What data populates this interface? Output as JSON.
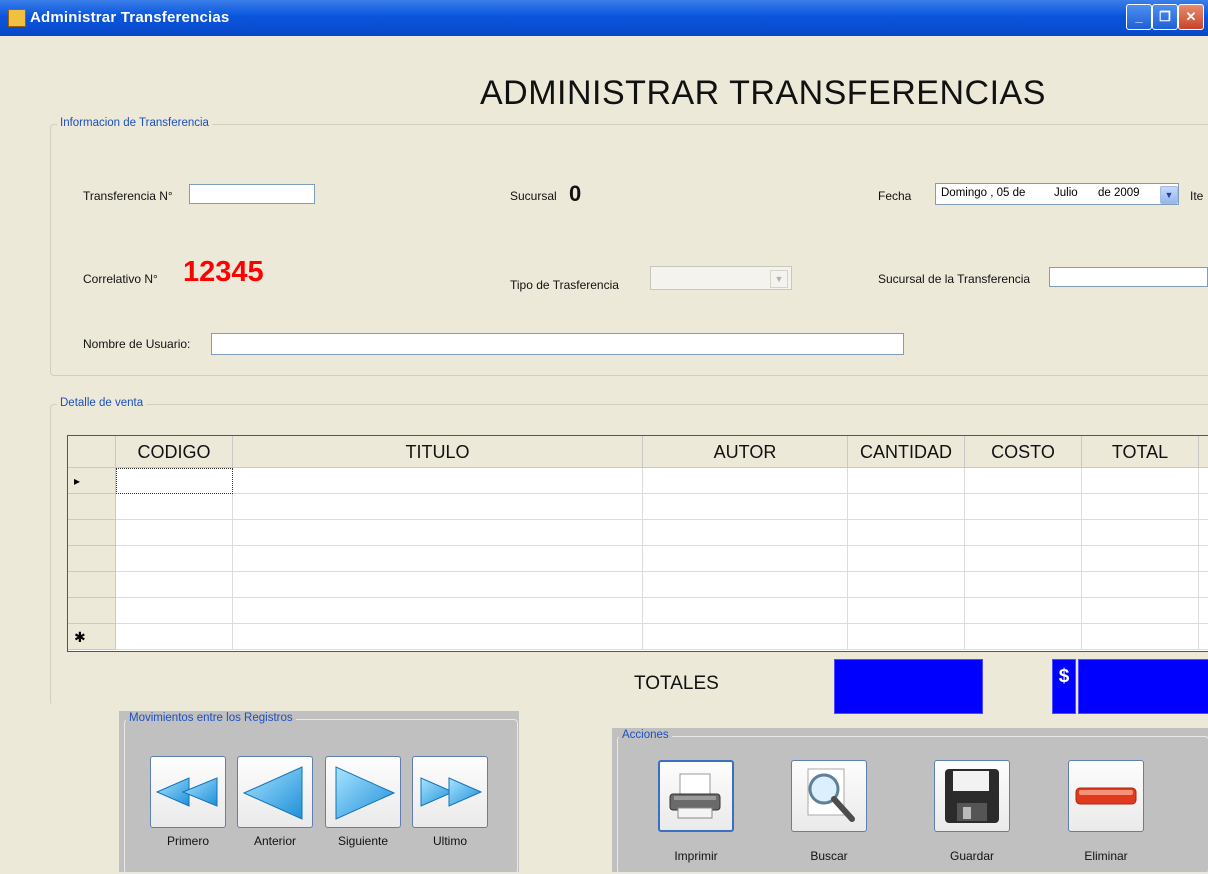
{
  "window": {
    "title": "Administrar Transferencias",
    "minimize_glyph": "_",
    "maximize_glyph": "❐",
    "close_glyph": "✕"
  },
  "page_title": "ADMINISTRAR TRANSFERENCIAS",
  "info_group": {
    "legend": "Informacion de Transferencia",
    "transferencia_label": "Transferencia N°",
    "transferencia_value": "",
    "sucursal_label": "Sucursal",
    "sucursal_value": "0",
    "fecha_label": "Fecha",
    "fecha_weekday": "Domingo , 05 de",
    "fecha_month": "Julio",
    "fecha_year": "de 2009",
    "items_label_partial": "Ite",
    "correlativo_label": "Correlativo N°",
    "correlativo_value": "12345",
    "tipo_label": "Tipo de Trasferencia",
    "tipo_value": "",
    "sucursal_transf_label": "Sucursal de la Transferencia",
    "sucursal_transf_value": "",
    "usuario_label": "Nombre de Usuario:",
    "usuario_value": ""
  },
  "detail_group": {
    "legend": "Detalle de venta",
    "columns": [
      "CODIGO",
      "TITULO",
      "AUTOR",
      "CANTIDAD",
      "COSTO",
      "TOTAL"
    ],
    "current_row_marker": "▸",
    "new_row_marker": "✱"
  },
  "totals": {
    "label": "TOTALES",
    "currency_symbol": "$",
    "colors": {
      "box": "#0000ff"
    }
  },
  "nav_group": {
    "legend": "Movimientos entre los Registros",
    "buttons": [
      {
        "label": "Primero",
        "icon": "double-left-arrow-icon"
      },
      {
        "label": "Anterior",
        "icon": "left-arrow-icon"
      },
      {
        "label": "Siguiente",
        "icon": "right-arrow-icon"
      },
      {
        "label": "Ultimo",
        "icon": "double-right-arrow-icon"
      }
    ]
  },
  "actions_group": {
    "legend": "Acciones",
    "buttons": [
      {
        "label": "Imprimir",
        "icon": "printer-icon"
      },
      {
        "label": "Buscar",
        "icon": "magnifier-icon"
      },
      {
        "label": "Guardar",
        "icon": "floppy-disk-icon"
      },
      {
        "label": "Eliminar",
        "icon": "remove-bar-icon"
      }
    ]
  },
  "colors": {
    "accent_blue": "#1c4fbe",
    "correlativo_red": "#ff0000",
    "window_bg": "#ece9d8"
  }
}
